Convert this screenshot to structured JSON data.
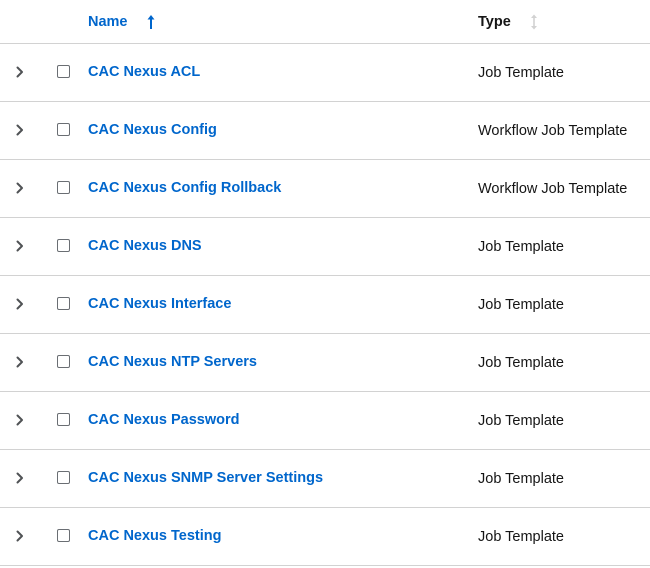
{
  "header": {
    "name_label": "Name",
    "type_label": "Type",
    "sort_active_icon": "arrow-up-icon",
    "sort_idle_icon": "sort-icon"
  },
  "colors": {
    "link": "#0066cc",
    "text": "#151515",
    "border": "#d2d2d2"
  },
  "rows": [
    {
      "name": "CAC Nexus ACL",
      "type": "Job Template"
    },
    {
      "name": "CAC Nexus Config",
      "type": "Workflow Job Template"
    },
    {
      "name": "CAC Nexus Config Rollback",
      "type": "Workflow Job Template"
    },
    {
      "name": "CAC Nexus DNS",
      "type": "Job Template"
    },
    {
      "name": "CAC Nexus Interface",
      "type": "Job Template"
    },
    {
      "name": "CAC Nexus NTP Servers",
      "type": "Job Template"
    },
    {
      "name": "CAC Nexus Password",
      "type": "Job Template"
    },
    {
      "name": "CAC Nexus SNMP Server Settings",
      "type": "Job Template"
    },
    {
      "name": "CAC Nexus Testing",
      "type": "Job Template"
    }
  ]
}
